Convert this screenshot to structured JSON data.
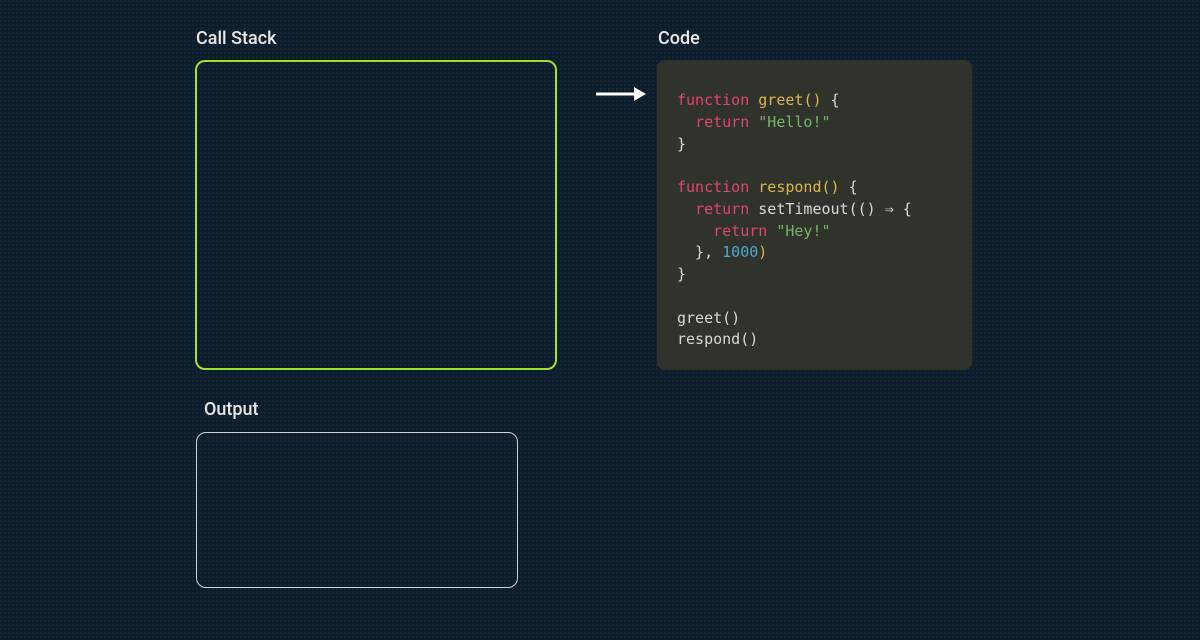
{
  "labels": {
    "callStack": "Call Stack",
    "output": "Output",
    "code": "Code"
  },
  "code": {
    "tokens": [
      [
        [
          "kw",
          "function "
        ],
        [
          "fn",
          "greet"
        ],
        [
          "punct",
          "()"
        ],
        [
          "plain",
          " {"
        ]
      ],
      [
        [
          "plain",
          "  "
        ],
        [
          "kw",
          "return "
        ],
        [
          "str",
          "\"Hello!\""
        ]
      ],
      [
        [
          "plain",
          "}"
        ]
      ],
      [
        [
          "plain",
          ""
        ]
      ],
      [
        [
          "kw",
          "function "
        ],
        [
          "fn",
          "respond"
        ],
        [
          "punct",
          "()"
        ],
        [
          "plain",
          " {"
        ]
      ],
      [
        [
          "plain",
          "  "
        ],
        [
          "kw",
          "return "
        ],
        [
          "plain",
          "setTimeout(() ⇒ {"
        ]
      ],
      [
        [
          "plain",
          "    "
        ],
        [
          "kw",
          "return "
        ],
        [
          "str",
          "\"Hey!\""
        ]
      ],
      [
        [
          "plain",
          "  }, "
        ],
        [
          "num",
          "1000"
        ],
        [
          "punct",
          ")"
        ]
      ],
      [
        [
          "plain",
          "}"
        ]
      ],
      [
        [
          "plain",
          ""
        ]
      ],
      [
        [
          "plain",
          "greet()"
        ]
      ],
      [
        [
          "plain",
          "respond()"
        ]
      ]
    ]
  }
}
